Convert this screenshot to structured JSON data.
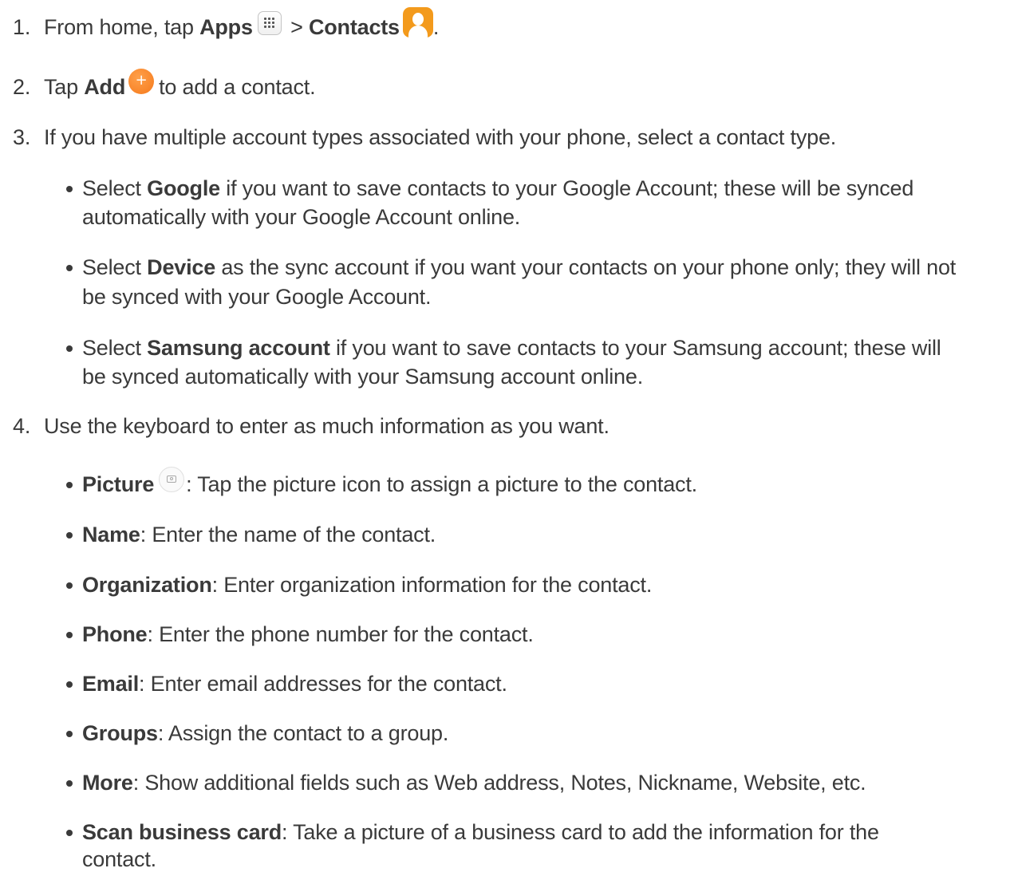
{
  "steps": [
    {
      "number": "1.",
      "parts": {
        "a": "From home, tap ",
        "b": "Apps",
        "c": " > ",
        "d": "Contacts",
        "e": "."
      }
    },
    {
      "number": "2.",
      "parts": {
        "a": "Tap ",
        "b": "Add",
        "c": "to add a contact."
      }
    },
    {
      "number": "3.",
      "text": "If you have multiple account types associated with your phone, select a contact type."
    },
    {
      "number": "4.",
      "text": "Use the keyboard to enter as much information as you want."
    }
  ],
  "account_bullets": [
    {
      "pre": "Select ",
      "bold": "Google",
      "line1": " if you want to save contacts to your Google Account; these will be synced",
      "line2": "automatically with your Google Account online."
    },
    {
      "pre": "Select ",
      "bold": "Device",
      "line1": " as the sync account if you want your contacts on your phone only; they will not",
      "line2": "be synced with your Google Account."
    },
    {
      "pre": "Select ",
      "bold": "Samsung account",
      "line1": " if you want to save contacts to your Samsung account; these will",
      "line2": "be synced automatically with your Samsung account online."
    }
  ],
  "field_bullets": [
    {
      "term": "Picture",
      "desc": ": Tap the picture icon to assign a picture to the contact."
    },
    {
      "term": "Name",
      "desc": ": Enter the name of the contact."
    },
    {
      "term": "Organization",
      "desc": ": Enter organization information for the contact."
    },
    {
      "term": "Phone",
      "desc": ": Enter the phone number for the contact."
    },
    {
      "term": "Email",
      "desc": ": Enter email addresses for the contact."
    },
    {
      "term": "Groups",
      "desc": ": Assign the contact to a group."
    },
    {
      "term": "More",
      "desc": ": Show additional fields such as Web address, Notes, Nickname, Website, etc."
    },
    {
      "term": "Scan business card",
      "desc": ": Take a picture of a business card to add the information for the",
      "desc2": "contact."
    }
  ],
  "icons": {
    "apps": "apps-grid-icon",
    "contacts": "contacts-icon",
    "add": "add-plus-icon",
    "picture": "camera-icon"
  },
  "colors": {
    "text": "#3a3a3a",
    "contacts_icon": "#f39a1c",
    "add_icon": "#f57a1c"
  }
}
